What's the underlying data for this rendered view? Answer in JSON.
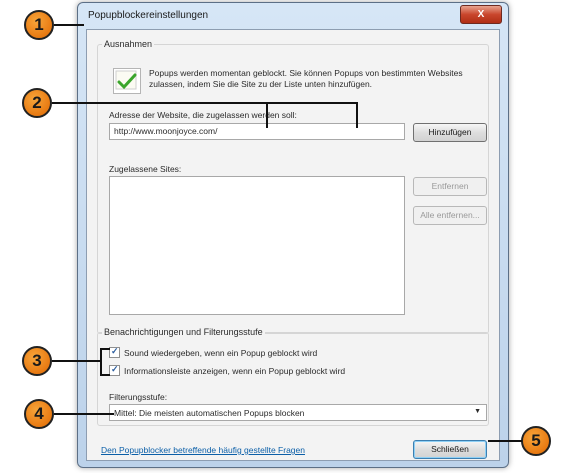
{
  "window": {
    "title": "Popupblockereinstellungen",
    "close_label": "X"
  },
  "exceptions": {
    "group_title": "Ausnahmen",
    "info_text": "Popups werden momentan geblockt. Sie können Popups von bestimmten Websites zulassen, indem Sie die Site zu der Liste unten hinzufügen.",
    "address_label": "Adresse der Website, die zugelassen werden soll:",
    "address_value": "http://www.moonjoyce.com/",
    "add_button": "Hinzufügen",
    "allowed_label": "Zugelassene Sites:",
    "remove_button": "Entfernen",
    "remove_all_button": "Alle entfernen..."
  },
  "notifications": {
    "group_title": "Benachrichtigungen und Filterungsstufe",
    "sound_label": "Sound wiedergeben, wenn ein Popup geblockt wird",
    "sound_checked": true,
    "infobar_label": "Informationsleiste anzeigen, wenn ein Popup geblockt wird",
    "infobar_checked": true,
    "filter_label": "Filterungsstufe:",
    "filter_value": "Mittel: Die meisten automatischen Popups blocken"
  },
  "footer": {
    "faq_link": "Den Popupblocker betreffende häufig gestellte Fragen",
    "close_button": "Schließen"
  },
  "callouts": [
    "1",
    "2",
    "3",
    "4",
    "5"
  ],
  "colors": {
    "callout": "#e87a12",
    "link": "#0b5fa8",
    "close_button": "#c9462c"
  }
}
